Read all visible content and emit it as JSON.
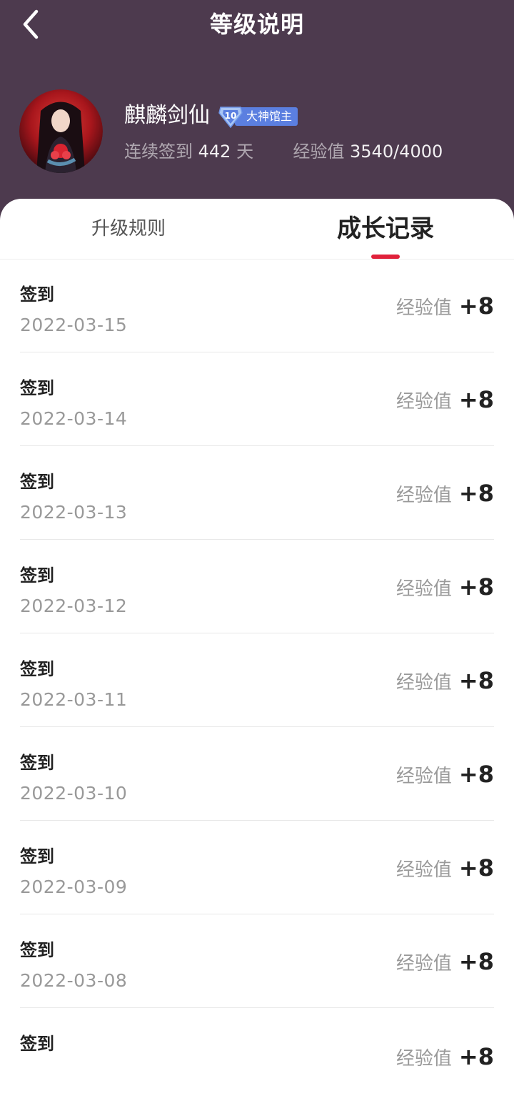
{
  "header": {
    "title": "等级说明",
    "back_icon": "chevron-left-icon"
  },
  "profile": {
    "username": "麒麟剑仙",
    "level": "10",
    "badge_label": "大神馆主",
    "checkin_label": "连续签到",
    "checkin_days": "442",
    "checkin_unit": "天",
    "exp_label": "经验值",
    "exp_value": "3540/4000"
  },
  "tabs": [
    {
      "label": "升级规则",
      "active": false
    },
    {
      "label": "成长记录",
      "active": true
    }
  ],
  "records": [
    {
      "title": "签到",
      "date": "2022-03-15",
      "exp_label": "经验值",
      "exp_value": "+8"
    },
    {
      "title": "签到",
      "date": "2022-03-14",
      "exp_label": "经验值",
      "exp_value": "+8"
    },
    {
      "title": "签到",
      "date": "2022-03-13",
      "exp_label": "经验值",
      "exp_value": "+8"
    },
    {
      "title": "签到",
      "date": "2022-03-12",
      "exp_label": "经验值",
      "exp_value": "+8"
    },
    {
      "title": "签到",
      "date": "2022-03-11",
      "exp_label": "经验值",
      "exp_value": "+8"
    },
    {
      "title": "签到",
      "date": "2022-03-10",
      "exp_label": "经验值",
      "exp_value": "+8"
    },
    {
      "title": "签到",
      "date": "2022-03-09",
      "exp_label": "经验值",
      "exp_value": "+8"
    },
    {
      "title": "签到",
      "date": "2022-03-08",
      "exp_label": "经验值",
      "exp_value": "+8"
    },
    {
      "title": "签到",
      "date": "",
      "exp_label": "经验值",
      "exp_value": "+8"
    }
  ],
  "colors": {
    "header_bg": "#4d3a4e",
    "accent": "#e0213a",
    "badge": "#5b7fe0"
  }
}
